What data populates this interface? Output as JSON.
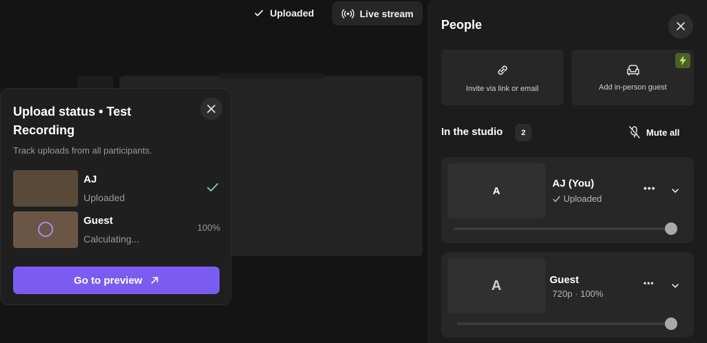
{
  "topbar": {
    "status_label": "Uploaded",
    "live_stream_label": "Live stream"
  },
  "upload_panel": {
    "title": "Upload status • Test Recording",
    "subtitle": "Track uploads from all participants.",
    "rows": [
      {
        "name": "AJ",
        "state": "Uploaded",
        "right": ""
      },
      {
        "name": "Guest",
        "state": "Calculating...",
        "right": "100%"
      }
    ],
    "preview_button": "Go to preview"
  },
  "people": {
    "title": "People",
    "invite_label": "Invite via link or email",
    "add_guest_label": "Add in-person guest",
    "studio_label": "In the studio",
    "studio_count": "2",
    "mute_all_label": "Mute all",
    "participants": [
      {
        "avatar": "A",
        "name": "AJ (You)",
        "status": "Uploaded",
        "volume": 1.0
      },
      {
        "avatar": "A",
        "name": "Guest",
        "status": "720p · 100%",
        "volume": 1.0
      }
    ]
  },
  "icons": {
    "uploaded": "check-icon",
    "live": "broadcast-icon",
    "close": "close-icon",
    "preview": "arrow-up-right-icon",
    "invite": "link-icon",
    "guest": "armchair-icon",
    "boost": "bolt-icon",
    "mute": "mic-off-icon",
    "more": "more-icon",
    "expand": "chevron-down-icon",
    "upload": "cloud-upload-icon"
  },
  "colors": {
    "accent": "#7b5cf0",
    "success": "#7ed9b0",
    "boost": "#b7e35a"
  }
}
